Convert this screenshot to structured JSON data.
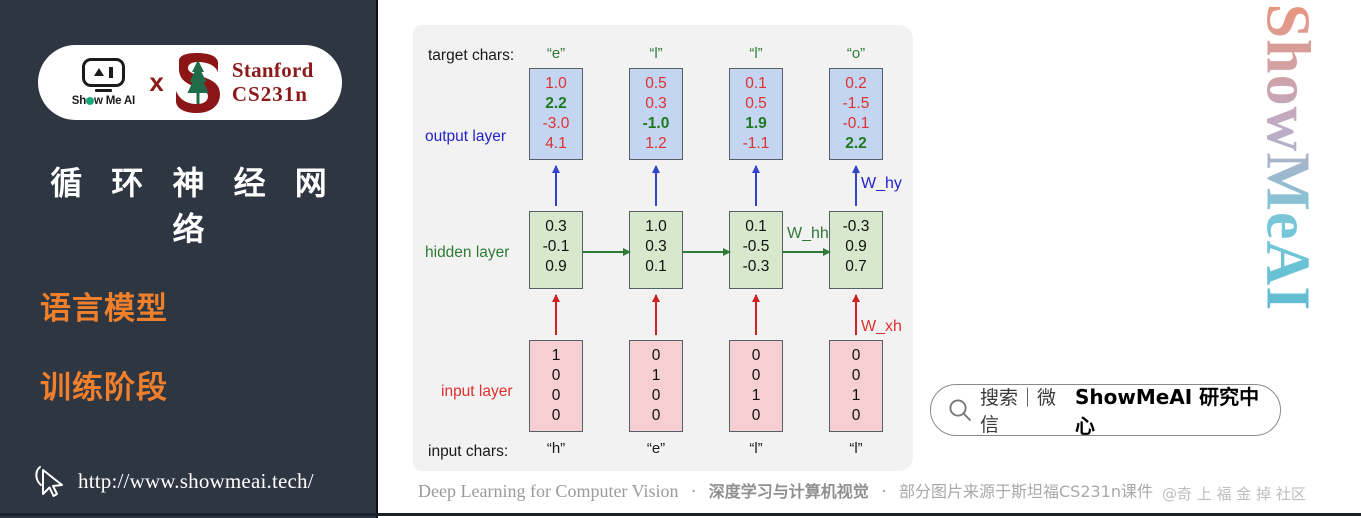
{
  "sidebar": {
    "logo": {
      "showmeai_wordmark": "Show Me AI",
      "cross": "x",
      "stanford_line1": "Stanford",
      "stanford_line2": "CS231n"
    },
    "title": "循 环 神 经 网 络",
    "subtitle_1": "语言模型",
    "subtitle_2": "训练阶段",
    "url": "http://www.showmeai.tech/"
  },
  "diagram": {
    "labels": {
      "target_chars": "target chars:",
      "output_layer": "output layer",
      "hidden_layer": "hidden layer",
      "input_layer": "input layer",
      "input_chars": "input chars:"
    },
    "weights": {
      "w_hy": "W_hy",
      "w_hh": "W_hh",
      "w_xh": "W_xh"
    },
    "columns": [
      {
        "target_char": "“e”",
        "input_char": "“h”",
        "output": [
          {
            "value": "1.0",
            "color": "red"
          },
          {
            "value": "2.2",
            "color": "green"
          },
          {
            "value": "-3.0",
            "color": "red"
          },
          {
            "value": "4.1",
            "color": "red"
          }
        ],
        "hidden": [
          "0.3",
          "-0.1",
          "0.9"
        ],
        "input": [
          "1",
          "0",
          "0",
          "0"
        ]
      },
      {
        "target_char": "“l”",
        "input_char": "“e”",
        "output": [
          {
            "value": "0.5",
            "color": "red"
          },
          {
            "value": "0.3",
            "color": "red"
          },
          {
            "value": "-1.0",
            "color": "green"
          },
          {
            "value": "1.2",
            "color": "red"
          }
        ],
        "hidden": [
          "1.0",
          "0.3",
          "0.1"
        ],
        "input": [
          "0",
          "1",
          "0",
          "0"
        ]
      },
      {
        "target_char": "“l”",
        "input_char": "“l”",
        "output": [
          {
            "value": "0.1",
            "color": "red"
          },
          {
            "value": "0.5",
            "color": "red"
          },
          {
            "value": "1.9",
            "color": "green"
          },
          {
            "value": "-1.1",
            "color": "red"
          }
        ],
        "hidden": [
          "0.1",
          "-0.5",
          "-0.3"
        ],
        "input": [
          "0",
          "0",
          "1",
          "0"
        ]
      },
      {
        "target_char": "“o”",
        "input_char": "“l”",
        "output": [
          {
            "value": "0.2",
            "color": "red"
          },
          {
            "value": "-1.5",
            "color": "red"
          },
          {
            "value": "-0.1",
            "color": "red"
          },
          {
            "value": "2.2",
            "color": "green"
          }
        ],
        "hidden": [
          "-0.3",
          "0.9",
          "0.7"
        ],
        "input": [
          "0",
          "0",
          "1",
          "0"
        ]
      }
    ],
    "colors": {
      "output_box": "#c3d5f0",
      "hidden_box": "#d7e8cd",
      "input_box": "#f5cfd1",
      "output_arrow": "#3344cc",
      "hidden_arrow": "#2f7a37",
      "input_arrow": "#cc2222",
      "panel_bg": "#f2f2f2"
    }
  },
  "search": {
    "placeholder": "搜索｜微信",
    "brand": "ShowMeAI 研究中心"
  },
  "watermark": {
    "vertical": "ShowMeAI",
    "bottom": "@奇 上 福 金 掉 社区"
  },
  "caption": {
    "en": "Deep Learning for Computer Vision",
    "sep": "·",
    "cn_bold": "深度学习与计算机视觉",
    "cn_normal": "部分图片来源于斯坦福CS231n课件"
  },
  "theme": {
    "sidebar_bg": "#2e3642",
    "accent_orange": "#f07f2b",
    "stanford_red": "#8b1a1a"
  }
}
